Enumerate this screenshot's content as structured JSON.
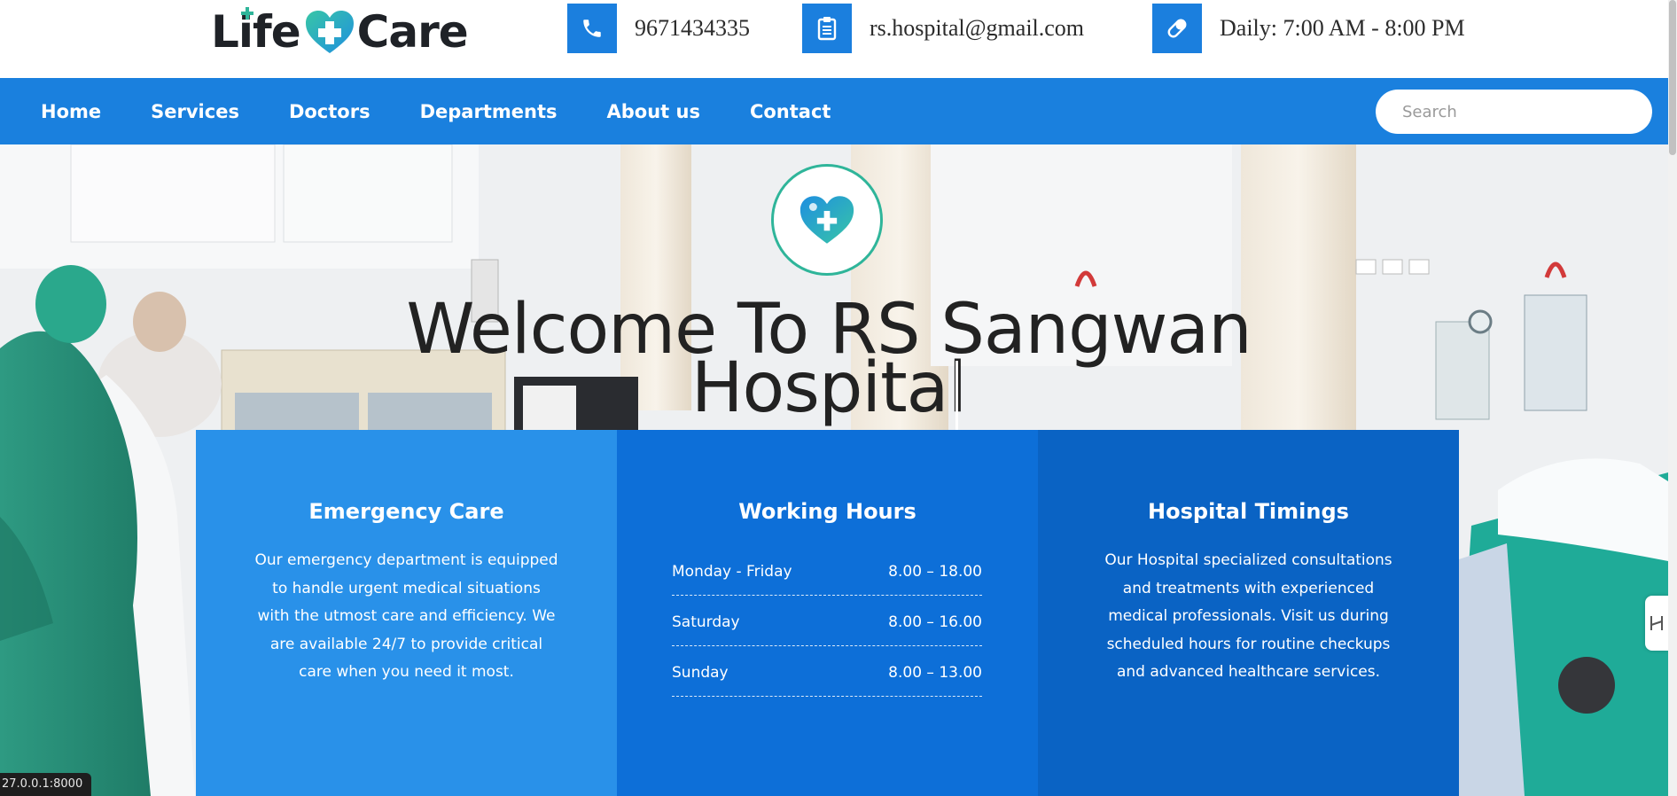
{
  "header": {
    "logo": {
      "part1": "Life",
      "part2": "Care"
    },
    "contacts": [
      {
        "icon": "phone-icon",
        "text": "9671434335"
      },
      {
        "icon": "clipboard-icon",
        "text": "rs.hospital@gmail.com"
      },
      {
        "icon": "pill-icon",
        "text": "Daily: 7:00 AM - 8:00 PM"
      }
    ]
  },
  "nav": {
    "items": [
      "Home",
      "Services",
      "Doctors",
      "Departments",
      "About us",
      "Contact"
    ],
    "search_placeholder": "Search"
  },
  "hero": {
    "badge_icon": "heart-plus-icon",
    "title_line1": "Welcome To RS Sangwan",
    "title_line2": "Hospital"
  },
  "cards": {
    "emergency": {
      "title": "Emergency Care",
      "text": "Our emergency department is equipped to handle urgent medical situations with the utmost care and efficiency. We are available 24/7 to provide critical care when you need it most."
    },
    "working_hours": {
      "title": "Working Hours",
      "rows": [
        {
          "day": "Monday - Friday",
          "time": "8.00 – 18.00"
        },
        {
          "day": "Saturday",
          "time": "8.00 – 16.00"
        },
        {
          "day": "Sunday",
          "time": "8.00 – 13.00"
        }
      ]
    },
    "timings": {
      "title": "Hospital Timings",
      "text": "Our Hospital specialized consultations and treatments with experienced medical professionals. Visit us during scheduled hours for routine checkups and advanced healthcare services."
    }
  },
  "status_bar": {
    "url": "27.0.0.1:8000"
  },
  "colors": {
    "primary": "#1a80de",
    "teal": "#2fb59a",
    "card1": "#2991e9",
    "card2": "#0d6fd8",
    "card3": "#0a63c4"
  }
}
